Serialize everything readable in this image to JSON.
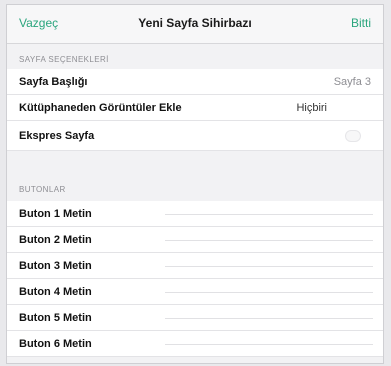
{
  "navbar": {
    "cancel_label": "Vazgeç",
    "title": "Yeni Sayfa Sihirbazı",
    "done_label": "Bitti"
  },
  "sections": {
    "page_options": "SAYFA SEÇENEKLERİ",
    "buttons": "BUTONLAR"
  },
  "page_rows": {
    "title_label": "Sayfa Başlığı",
    "title_value": "Sayfa 3",
    "images_label": "Kütüphaneden Görüntüler Ekle",
    "images_value": "Hiçbiri",
    "express_label": "Ekspres Sayfa"
  },
  "button_rows": [
    {
      "label": "Buton 1 Metin"
    },
    {
      "label": "Buton 2 Metin"
    },
    {
      "label": "Buton 3 Metin"
    },
    {
      "label": "Buton 4 Metin"
    },
    {
      "label": "Buton 5 Metin"
    },
    {
      "label": "Buton 6 Metin"
    }
  ]
}
